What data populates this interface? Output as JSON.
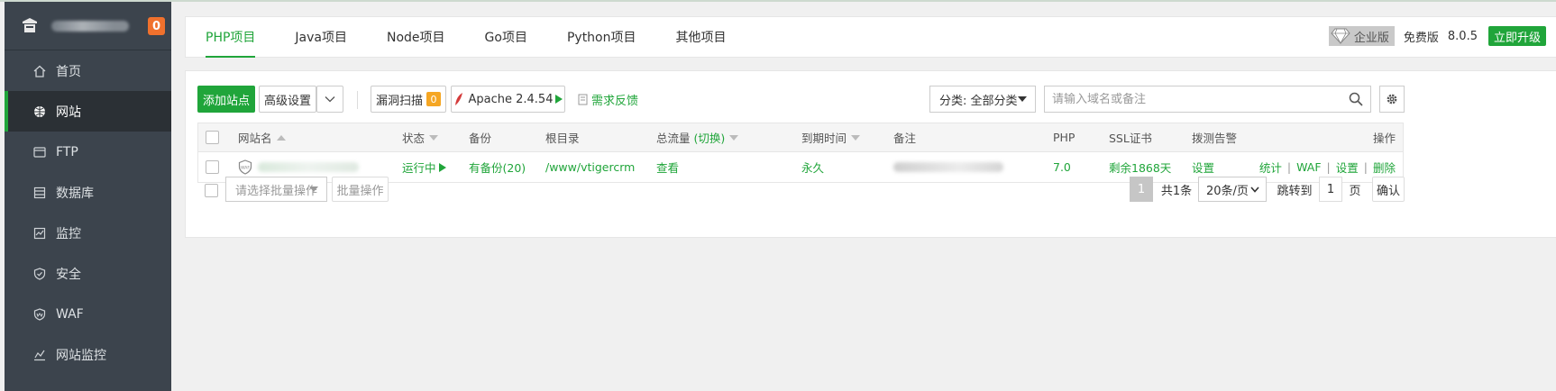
{
  "sidebar": {
    "badge": "0",
    "items": [
      {
        "label": "首页",
        "icon": "home-icon"
      },
      {
        "label": "网站",
        "icon": "globe-icon",
        "active": true
      },
      {
        "label": "FTP",
        "icon": "ftp-icon"
      },
      {
        "label": "数据库",
        "icon": "database-icon"
      },
      {
        "label": "监控",
        "icon": "monitor-icon"
      },
      {
        "label": "安全",
        "icon": "shield-icon"
      },
      {
        "label": "WAF",
        "icon": "waf-icon"
      },
      {
        "label": "网站监控",
        "icon": "chart-line-icon"
      }
    ]
  },
  "tabs": [
    {
      "label": "PHP项目",
      "active": true
    },
    {
      "label": "Java项目"
    },
    {
      "label": "Node项目"
    },
    {
      "label": "Go项目"
    },
    {
      "label": "Python项目"
    },
    {
      "label": "其他项目"
    }
  ],
  "version": {
    "enterprise": "企业版",
    "free": "免费版",
    "number": "8.0.5",
    "upgrade": "立即升级"
  },
  "toolbar": {
    "add_site": "添加站点",
    "advanced": "高级设置",
    "scan": "漏洞扫描",
    "scan_count": "0",
    "apache": "Apache 2.4.54",
    "feedback": "需求反馈",
    "category": "分类: 全部分类",
    "search_placeholder": "请输入域名或备注"
  },
  "table": {
    "headers": {
      "name": "网站名",
      "status": "状态",
      "backup": "备份",
      "root": "根目录",
      "traffic": "总流量",
      "traffic_switch": "(切换)",
      "expire": "到期时间",
      "remark": "备注",
      "php": "PHP",
      "ssl": "SSL证书",
      "alert": "拨测告警",
      "actions": "操作"
    },
    "rows": [
      {
        "status": "运行中",
        "backup": "有备份(20)",
        "root": "/www/vtigercrm",
        "traffic": "查看",
        "expire": "永久",
        "php": "7.0",
        "ssl": "剩余1868天",
        "alert": "设置",
        "actions": [
          "统计",
          "WAF",
          "设置",
          "删除"
        ]
      }
    ]
  },
  "footer": {
    "batch_placeholder": "请选择批量操作",
    "batch_button": "批量操作",
    "current_page": "1",
    "total": "共1条",
    "per_page": "20条/页",
    "jump_label": "跳转到",
    "jump_value": "1",
    "page_unit": "页",
    "confirm": "确认"
  },
  "colors": {
    "accent": "#20a53a",
    "sidebar_bg": "#3c444d",
    "badge": "#f0712d"
  }
}
